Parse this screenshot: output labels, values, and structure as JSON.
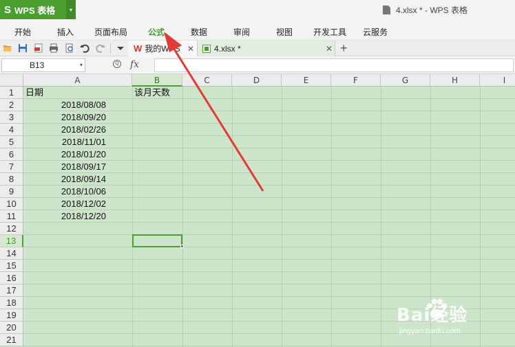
{
  "app": {
    "name": "WPS 表格",
    "window_title": "4.xlsx * - WPS 表格"
  },
  "menu": {
    "items": [
      "开始",
      "插入",
      "页面布局",
      "公式",
      "数据",
      "审阅",
      "视图",
      "开发工具",
      "云服务"
    ],
    "active": "公式"
  },
  "doc_tabs": [
    {
      "label": "我的WPS"
    },
    {
      "label": "4.xlsx *"
    }
  ],
  "formula_bar": {
    "name_box": "B13",
    "fx": "fx",
    "value": ""
  },
  "grid": {
    "columns": [
      "A",
      "B",
      "C",
      "D",
      "E",
      "F",
      "G",
      "H",
      "I"
    ],
    "rows": [
      "1",
      "2",
      "3",
      "4",
      "5",
      "6",
      "7",
      "8",
      "9",
      "10",
      "11",
      "12",
      "13",
      "14",
      "15",
      "16",
      "17",
      "18",
      "19",
      "20",
      "21"
    ],
    "selected_cell": "B13",
    "header_a1": "日期",
    "header_b1": "该月天数",
    "dates": [
      "2018/08/08",
      "2018/09/20",
      "2018/02/26",
      "2018/11/01",
      "2018/01/20",
      "2018/09/17",
      "2018/09/14",
      "2018/10/06",
      "2018/12/02",
      "2018/12/20"
    ]
  },
  "annotation": {
    "arrow_color": "#e53935"
  },
  "watermark": {
    "brand": "Bai经验",
    "url": "jingyan.baidu.com"
  },
  "colors": {
    "accent": "#4a9f2e",
    "sheet_bg": "#cde5cb"
  }
}
